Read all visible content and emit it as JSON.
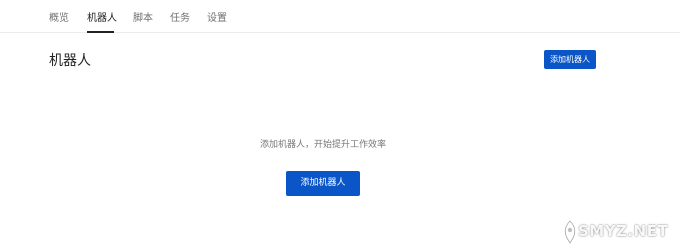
{
  "tabs": [
    {
      "label": "概览",
      "active": false
    },
    {
      "label": "机器人",
      "active": true
    },
    {
      "label": "脚本",
      "active": false
    },
    {
      "label": "任务",
      "active": false
    },
    {
      "label": "设置",
      "active": false
    }
  ],
  "header": {
    "title": "机器人",
    "add_button_label": "添加机器人"
  },
  "empty_state": {
    "message": "添加机器人，开始提升工作效率",
    "button_label": "添加机器人"
  },
  "watermark": {
    "text": "SMYZ.NET"
  },
  "colors": {
    "primary": "#0a56c8",
    "text_dark": "#222222",
    "text_muted": "#777777"
  }
}
